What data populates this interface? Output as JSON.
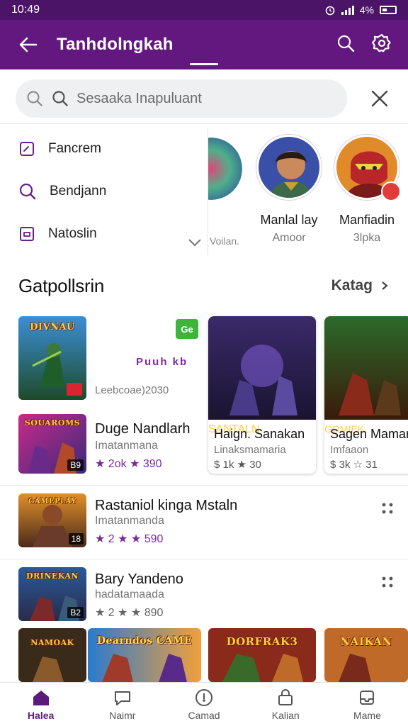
{
  "status_bar": {
    "time": "10:49",
    "battery": "4%"
  },
  "app_bar": {
    "title": "Tanhdolngkah"
  },
  "search": {
    "placeholder": "Sesaaka Inapuluant"
  },
  "drawer": {
    "items": [
      {
        "label": "Fancrem",
        "icon": "edit-square-icon"
      },
      {
        "label": "Bendjann",
        "icon": "search-icon"
      },
      {
        "label": "Natoslin",
        "icon": "box-icon"
      }
    ]
  },
  "stories": [
    {
      "name": "",
      "sub": "Voilan."
    },
    {
      "name": "Manlal lay",
      "sub": "Amoor"
    },
    {
      "name": "Manfiadin",
      "sub": "3lpka"
    }
  ],
  "section": {
    "title": "Gatpollsrin",
    "more": "Katag"
  },
  "featured": {
    "art_title": "DIVNAU",
    "promo_text": "Puuh kb",
    "caption": "Leebcoae)2030",
    "badge": "Ge"
  },
  "list": [
    {
      "art_title": "SOUAROMS",
      "title": "Duge Nandlarh",
      "sub": "Imatanmana",
      "rating": "★ 2ok ★ 390",
      "badge": "B9"
    },
    {
      "art_title": "GAMEPLAY",
      "title": "Rastaniol kinga Mstaln",
      "sub": "Imatanmanda",
      "rating": "★ 2 ★ ★ 590",
      "badge": "18"
    },
    {
      "art_title": "DRINEKAN",
      "title": "Bary Yandeno",
      "sub": "hadatamaada",
      "rating": "★ 2 ★ ★ 890",
      "badge": "B2"
    }
  ],
  "cards": [
    {
      "art_title": "SANTALN",
      "title": "Haign. Sanakan",
      "sub": "Linaksmamaria",
      "rating": "$ 1k ★ 30"
    },
    {
      "art_title": "GOMIEK",
      "title": "Sagen Mamar",
      "sub": "Imfaaon",
      "rating": "$ 3k ☆ 31"
    }
  ],
  "bottom_row": [
    {
      "art_title": "NAMOAK"
    },
    {
      "art_title": "Dearndos CAME"
    },
    {
      "art_title": "DORFRAK3"
    },
    {
      "art_title": "NAIKAN"
    }
  ],
  "bottom_nav": [
    {
      "label": "Halea",
      "icon": "home-icon",
      "active": true
    },
    {
      "label": "Naimr",
      "icon": "chat-bubble-icon",
      "active": false
    },
    {
      "label": "Camad",
      "icon": "compass-icon",
      "active": false
    },
    {
      "label": "Kalian",
      "icon": "bag-icon",
      "active": false
    },
    {
      "label": "Mame",
      "icon": "inbox-icon",
      "active": false
    }
  ],
  "colors": {
    "primary": "#63187f",
    "status_bar": "#4b1466",
    "accent": "#7b2a9c"
  }
}
